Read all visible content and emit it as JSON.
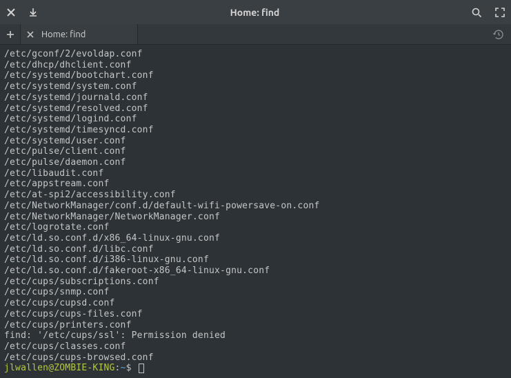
{
  "titlebar": {
    "title": "Home: find"
  },
  "tab": {
    "label": "Home: find"
  },
  "output": [
    "/etc/gconf/2/evoldap.conf",
    "/etc/dhcp/dhclient.conf",
    "/etc/systemd/bootchart.conf",
    "/etc/systemd/system.conf",
    "/etc/systemd/journald.conf",
    "/etc/systemd/resolved.conf",
    "/etc/systemd/logind.conf",
    "/etc/systemd/timesyncd.conf",
    "/etc/systemd/user.conf",
    "/etc/pulse/client.conf",
    "/etc/pulse/daemon.conf",
    "/etc/libaudit.conf",
    "/etc/appstream.conf",
    "/etc/at-spi2/accessibility.conf",
    "/etc/NetworkManager/conf.d/default-wifi-powersave-on.conf",
    "/etc/NetworkManager/NetworkManager.conf",
    "/etc/logrotate.conf",
    "/etc/ld.so.conf.d/x86_64-linux-gnu.conf",
    "/etc/ld.so.conf.d/libc.conf",
    "/etc/ld.so.conf.d/i386-linux-gnu.conf",
    "/etc/ld.so.conf.d/fakeroot-x86_64-linux-gnu.conf",
    "/etc/cups/subscriptions.conf",
    "/etc/cups/snmp.conf",
    "/etc/cups/cupsd.conf",
    "/etc/cups/cups-files.conf",
    "/etc/cups/printers.conf",
    "find: '/etc/cups/ssl': Permission denied",
    "/etc/cups/classes.conf",
    "/etc/cups/cups-browsed.conf"
  ],
  "prompt": {
    "user_host": "jlwallen@ZOMBIE-KING",
    "sep1": ":",
    "path": "~",
    "suffix": "$"
  }
}
